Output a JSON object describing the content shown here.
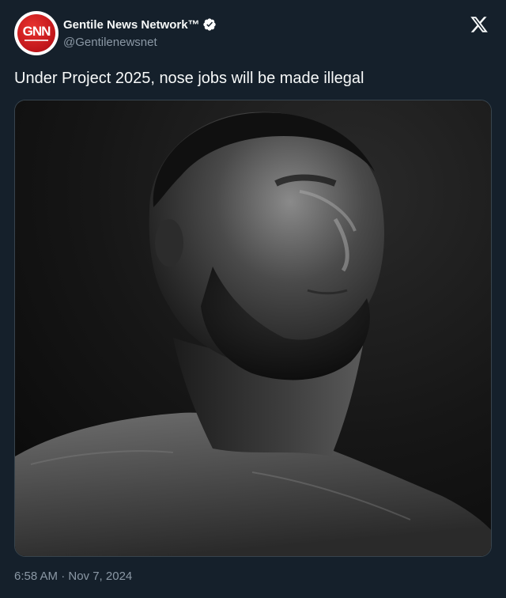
{
  "account": {
    "display_name": "Gentile News Network™",
    "handle": "@Gentilenewsnet",
    "avatar_text": "GNN",
    "verified": true
  },
  "tweet": {
    "text": "Under Project 2025, nose jobs will be made illegal",
    "timestamp": "6:58 AM · Nov 7, 2024",
    "media": {
      "description_icon": "photo",
      "tone": "grayscale"
    }
  },
  "brand": {
    "logo": "x-logo-icon"
  },
  "colors": {
    "background": "#15202b",
    "primary_text": "#f7f9f9",
    "secondary_text": "#8b98a5",
    "border": "#38444d",
    "avatar_red": "#c0151a"
  }
}
